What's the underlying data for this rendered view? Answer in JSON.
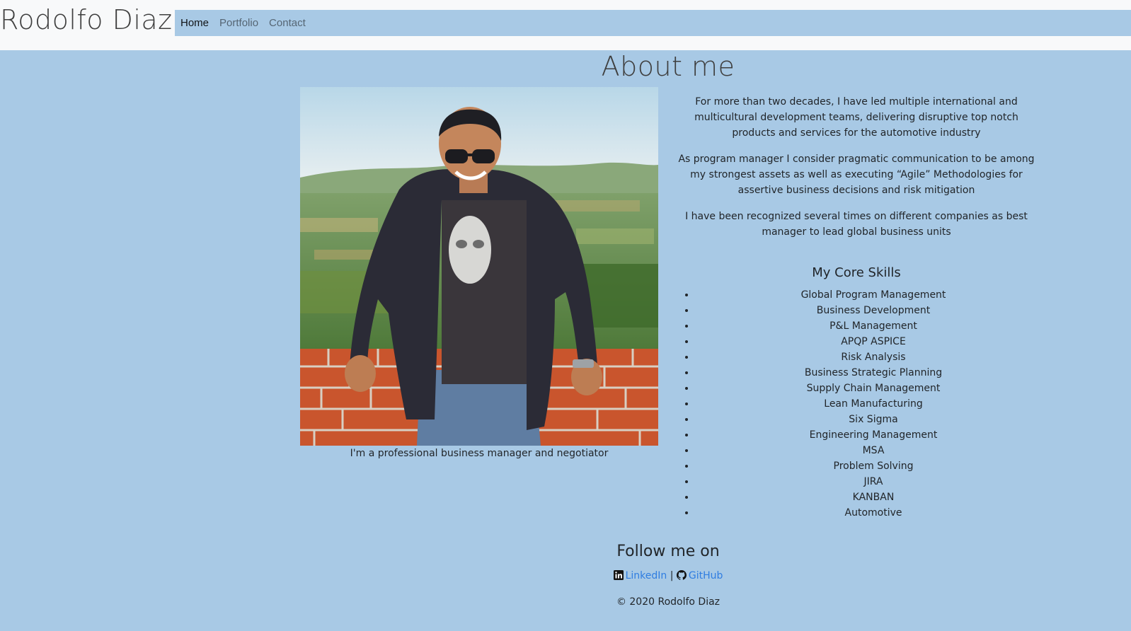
{
  "header": {
    "brand": "Rodolfo Diaz",
    "nav": [
      {
        "label": "Home",
        "active": true
      },
      {
        "label": "Portfolio",
        "active": false
      },
      {
        "label": "Contact",
        "active": false
      }
    ]
  },
  "about": {
    "title": "About me",
    "photo_caption": "I'm a professional business manager and negotiator",
    "paragraphs": [
      "For more than two decades, I have led multiple international and multicultural development teams, delivering disruptive top notch products and services for the automotive industry",
      "As program manager I consider pragmatic communication to be among my strongest assets as well as executing “Agile” Methodologies for assertive business decisions and risk mitigation",
      "I have been recognized several times on different companies as best manager to lead global business units"
    ],
    "skills_title": "My Core Skills",
    "skills": [
      "Global Program Management",
      "Business Development",
      "P&L Management",
      "APQP ASPICE",
      "Risk Analysis",
      "Business Strategic Planning",
      "Supply Chain Management",
      "Lean Manufacturing",
      "Six Sigma",
      "Engineering Management",
      "MSA",
      "Problem Solving",
      "JIRA",
      "KANBAN",
      "Automotive"
    ]
  },
  "footer": {
    "follow_title": "Follow me on",
    "linkedin_label": "LinkedIn",
    "separator": "|",
    "github_label": "GitHub",
    "copyright": "© 2020 Rodolfo Diaz",
    "link_color": "#2f7de1"
  },
  "colors": {
    "page_bg": "#a8c9e5",
    "header_bg": "#f8f9fa"
  },
  "icons": [
    "linkedin-icon",
    "github-icon"
  ]
}
